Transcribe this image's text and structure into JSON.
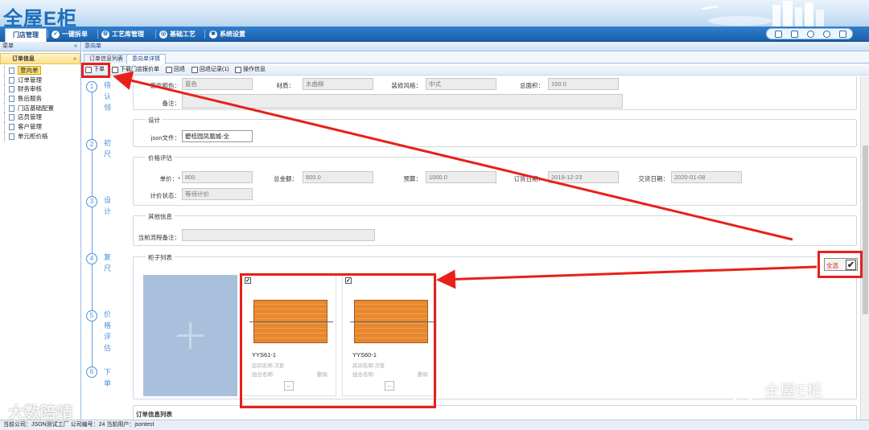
{
  "app": {
    "logo": "全屋E柜"
  },
  "nav": {
    "items": [
      {
        "label": "门店管理",
        "active": true,
        "icon": "home-icon"
      },
      {
        "label": "一键拆单",
        "icon": "check-circle-icon"
      },
      {
        "label": "工艺库管理",
        "icon": "gear-icon"
      },
      {
        "label": "基础工艺",
        "icon": "target-icon"
      },
      {
        "label": "系统设置",
        "icon": "settings-icon"
      }
    ]
  },
  "sidebar": {
    "header": "菜单",
    "collapse": "«",
    "group": "订单信息",
    "group_collapse": "«",
    "items": [
      {
        "label": "意向单",
        "selected": true
      },
      {
        "label": "订单管理"
      },
      {
        "label": "财务审核"
      },
      {
        "label": "售后服务"
      },
      {
        "label": "门店基础配置"
      },
      {
        "label": "店员管理"
      },
      {
        "label": "客户管理"
      },
      {
        "label": "单元柜价格"
      }
    ]
  },
  "main": {
    "breadcrumb": "意向单",
    "tabs": [
      {
        "label": "订单信息列表"
      },
      {
        "label": "意向单详情",
        "active": true
      }
    ],
    "toolbar": [
      {
        "label": "下单",
        "icon": "print-icon"
      },
      {
        "label": "下载门店报价单",
        "icon": "download-icon"
      },
      {
        "label": "回退",
        "icon": "back-icon"
      },
      {
        "label": "回退记录(1)",
        "icon": "record-icon"
      },
      {
        "label": "操作信息",
        "icon": "info-icon"
      }
    ],
    "steps": [
      {
        "n": "1",
        "label": "待认领"
      },
      {
        "n": "2",
        "label": "初尺"
      },
      {
        "n": "3",
        "label": "设计"
      },
      {
        "n": "4",
        "label": "复尺"
      },
      {
        "n": "5",
        "label": "价格评估"
      },
      {
        "n": "6",
        "label": "下单"
      }
    ],
    "basic": {
      "color_label": "喜欢颜色：",
      "color_value": "蓝色",
      "material_label": "材质：",
      "material_value": "水曲柳",
      "style_label": "装修风格：",
      "style_value": "中式",
      "area_label": "总面积：",
      "area_value": "150.0",
      "remark_label": "备注："
    },
    "design": {
      "title": "设计",
      "json_label": "json文件：",
      "json_value": "碧桂园凤凰城-全"
    },
    "price": {
      "title": "价格评估",
      "unit_label": "单价：",
      "unit_value": "800",
      "total_label": "总金额：",
      "total_value": "800.0",
      "budget_label": "预算：",
      "budget_value": "1000.0",
      "order_date_label": "订货日期：",
      "order_date_value": "2019-12-23",
      "delivery_label": "交货日期：",
      "delivery_value": "2020-01-08",
      "status_label": "计价状态：",
      "status_value": "等待计价"
    },
    "other": {
      "title": "其他信息",
      "remark_label": "当前流程备注："
    },
    "cabinets": {
      "title": "柜子列表",
      "select_all": "全选",
      "items": [
        {
          "code": "YYS61-1",
          "room": "房间名称:次卧",
          "group": "组合名称:",
          "del": "删除",
          "more": "..."
        },
        {
          "code": "YYS60-1",
          "room": "房间名称:次卧",
          "group": "组合名称:",
          "del": "删除",
          "more": "..."
        }
      ]
    },
    "order_list_title": "订单信息列表"
  },
  "status": {
    "text": "当前公司：JSON测试工厂   公司编号：24   当前用户：jsontest"
  },
  "watermarks": {
    "left": "大数陪靖",
    "right": "全屋E柜"
  },
  "colors": {
    "nav": "#1b5fa8",
    "accent": "#4a90d9",
    "annotation": "#e8201a"
  }
}
